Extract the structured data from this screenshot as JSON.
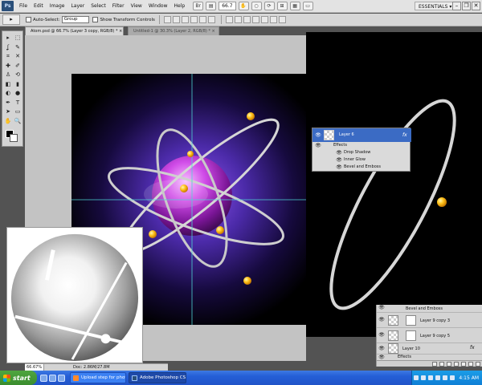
{
  "app": {
    "logo": "Ps"
  },
  "menu": {
    "items": [
      "File",
      "Edit",
      "Image",
      "Layer",
      "Select",
      "Filter",
      "View",
      "Window",
      "Help"
    ],
    "zoom": "66.7",
    "workspace": "ESSENTIALS",
    "workspace_arrow": "▾",
    "min": "–",
    "restore": "❐",
    "close": "✕"
  },
  "options": {
    "tool_glyph": "▸",
    "auto_select_label": "Auto-Select:",
    "auto_select_value": "Group",
    "show_transform_label": "Show Transform Controls"
  },
  "tabs": [
    {
      "label": "Atom.psd @ 66.7% (Layer 3 copy, RGB/8) *",
      "close": "×"
    },
    {
      "label": "Untitled-1 @ 30.3% (Layer 2, RGB/8) *",
      "close": "×"
    }
  ],
  "tools": [
    {
      "glyph": "▸",
      "name": "move-tool-icon"
    },
    {
      "glyph": "⬚",
      "name": "marquee-tool-icon"
    },
    {
      "glyph": "ʆ",
      "name": "lasso-tool-icon"
    },
    {
      "glyph": "✎",
      "name": "quick-select-tool-icon"
    },
    {
      "glyph": "⌗",
      "name": "crop-tool-icon"
    },
    {
      "glyph": "✕",
      "name": "eyedropper-tool-icon"
    },
    {
      "glyph": "✚",
      "name": "healing-brush-icon"
    },
    {
      "glyph": "✐",
      "name": "brush-tool-icon"
    },
    {
      "glyph": "♙",
      "name": "clone-stamp-icon"
    },
    {
      "glyph": "⟲",
      "name": "history-brush-icon"
    },
    {
      "glyph": "◧",
      "name": "eraser-tool-icon"
    },
    {
      "glyph": "▮",
      "name": "gradient-tool-icon"
    },
    {
      "glyph": "◐",
      "name": "dodge-tool-icon"
    },
    {
      "glyph": "●",
      "name": "blur-tool-icon"
    },
    {
      "glyph": "✒",
      "name": "pen-tool-icon"
    },
    {
      "glyph": "T",
      "name": "type-tool-icon"
    },
    {
      "glyph": "➤",
      "name": "path-select-icon"
    },
    {
      "glyph": "▭",
      "name": "shape-tool-icon"
    },
    {
      "glyph": "✋",
      "name": "hand-tool-icon"
    },
    {
      "glyph": "🔍",
      "name": "zoom-tool-icon"
    }
  ],
  "thumb_status": {
    "zoom": "66.67%",
    "doc": "Doc: 2.86M/27.8M"
  },
  "layers_popup": {
    "layer_name": "Layer 6",
    "fx": "fx",
    "effects_label": "Effects",
    "effects": [
      "Drop Shadow",
      "Inner Glow",
      "Bevel and Emboss"
    ]
  },
  "layers_panel": {
    "rows": [
      {
        "label": "Bevel and Emboss",
        "kind": "effect"
      },
      {
        "label": "Layer 9 copy 3",
        "kind": "mask"
      },
      {
        "label": "Layer 9 copy 5",
        "kind": "mask"
      },
      {
        "label": "Layer 10",
        "kind": "fx"
      },
      {
        "label": "Effects",
        "kind": "effect"
      }
    ],
    "fx": "fx"
  },
  "taskbar": {
    "start": "start",
    "tasks": [
      {
        "label": "Upload step for phot...",
        "icon": "ie"
      },
      {
        "label": "Adobe Photoshop CS...",
        "icon": "ps"
      }
    ],
    "time": "4:15 AM"
  },
  "colors": {
    "accent": "#3b6bc4",
    "taskbar": "#245ed6",
    "start": "#3a8d2e"
  }
}
